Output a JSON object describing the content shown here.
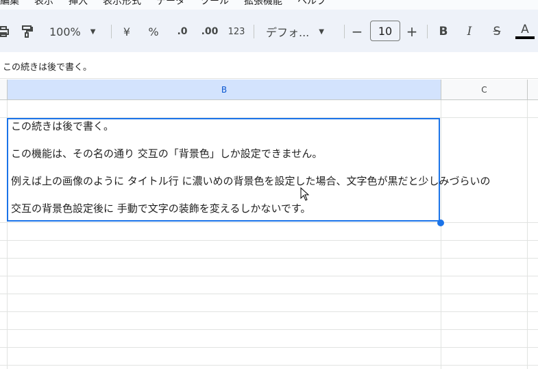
{
  "menu": {
    "items": [
      "編集",
      "表示",
      "挿入",
      "表示形式",
      "データ",
      "ツール",
      "拡張機能",
      "ヘルプ"
    ]
  },
  "toolbar": {
    "zoom": "100%",
    "currency": "¥",
    "percent": "%",
    "decrease_decimal": ".0",
    "increase_decimal": ".00",
    "number_format": "123",
    "font_name": "デフォ...",
    "font_size": "10",
    "minus": "−",
    "plus": "+",
    "bold": "B",
    "italic": "I",
    "strike": "S",
    "text_color": "A",
    "text_color_value": "#000000"
  },
  "formula_bar": {
    "text": "この続きは後で書く。"
  },
  "columns": [
    "B",
    "C"
  ],
  "cell": {
    "lines": [
      "この続きは後で書く。",
      "この機能は、その名の通り 交互の「背景色」しか設定できません。",
      "例えば上の画像のように タイトル行 に濃いめの背景色を設定した場合、文字色が黒だと少しみづらいの",
      "交互の背景色設定後に 手動で文字の装飾を変えるしかないです。"
    ]
  },
  "colors": {
    "selection": "#1a73e8",
    "selected_column_header": "#d3e3fd",
    "toolbar_bg": "#eef2f9"
  }
}
